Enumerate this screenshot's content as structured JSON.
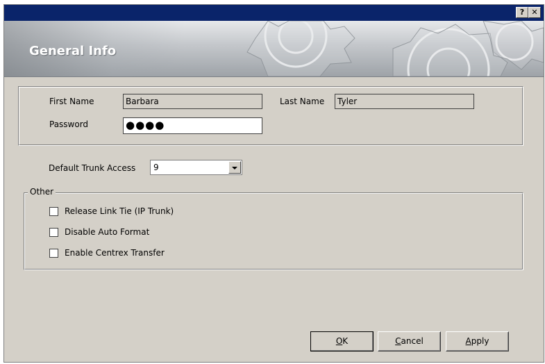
{
  "titlebar": {
    "help_label": "?",
    "close_label": "✕"
  },
  "banner": {
    "title": "General Info"
  },
  "form": {
    "first_name_label": "First Name",
    "first_name_value": "Barbara",
    "last_name_label": "Last Name",
    "last_name_value": "Tyler",
    "password_label": "Password",
    "password_mask": "●●●●"
  },
  "trunk": {
    "label": "Default Trunk Access",
    "value": "9"
  },
  "other": {
    "label": "Other",
    "options": [
      {
        "label": "Release Link Tie (IP Trunk)",
        "checked": false
      },
      {
        "label": "Disable Auto Format",
        "checked": false
      },
      {
        "label": "Enable Centrex Transfer",
        "checked": false
      }
    ]
  },
  "buttons": {
    "ok_mnemonic": "O",
    "ok_rest": "K",
    "cancel_mnemonic": "C",
    "cancel_rest": "ancel",
    "apply_mnemonic": "A",
    "apply_rest": "pply"
  },
  "colors": {
    "titlebar": "#0a246a",
    "dialog_bg": "#d4d0c8",
    "banner_text": "#ffffff"
  }
}
